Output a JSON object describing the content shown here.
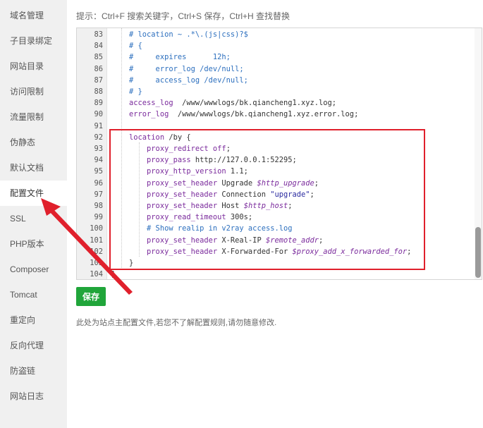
{
  "sidebar": {
    "items": [
      {
        "label": "域名管理"
      },
      {
        "label": "子目录绑定"
      },
      {
        "label": "网站目录"
      },
      {
        "label": "访问限制"
      },
      {
        "label": "流量限制"
      },
      {
        "label": "伪静态"
      },
      {
        "label": "默认文档"
      },
      {
        "label": "配置文件",
        "active": true
      },
      {
        "label": "SSL"
      },
      {
        "label": "PHP版本"
      },
      {
        "label": "Composer"
      },
      {
        "label": "Tomcat"
      },
      {
        "label": "重定向"
      },
      {
        "label": "反向代理"
      },
      {
        "label": "防盗链"
      },
      {
        "label": "网站日志"
      }
    ]
  },
  "tip": "提示：Ctrl+F 搜索关键字，Ctrl+S 保存，Ctrl+H 查找替换",
  "editor": {
    "lines": [
      {
        "n": "83",
        "segs": [
          [
            "c-cm",
            "    # location ~ .*\\.(js|css)?$"
          ]
        ]
      },
      {
        "n": "84",
        "segs": [
          [
            "c-cm",
            "    # {"
          ]
        ]
      },
      {
        "n": "85",
        "segs": [
          [
            "c-cm",
            "    #     expires      12h;"
          ]
        ]
      },
      {
        "n": "86",
        "segs": [
          [
            "c-cm",
            "    #     error_log /dev/null;"
          ]
        ]
      },
      {
        "n": "87",
        "segs": [
          [
            "c-cm",
            "    #     access_log /dev/null;"
          ]
        ]
      },
      {
        "n": "88",
        "segs": [
          [
            "c-cm",
            "    # }"
          ]
        ]
      },
      {
        "n": "89",
        "segs": [
          [
            "c-kw",
            "    access_log"
          ],
          [
            "c-plain",
            "  /www/wwwlogs/bk.qiancheng1.xyz.log;"
          ]
        ]
      },
      {
        "n": "90",
        "segs": [
          [
            "c-kw",
            "    error_log"
          ],
          [
            "c-plain",
            "  /www/wwwlogs/bk.qiancheng1.xyz.error.log;"
          ]
        ]
      },
      {
        "n": "91",
        "segs": [
          [
            "c-plain",
            ""
          ]
        ]
      },
      {
        "n": "92",
        "segs": [
          [
            "c-kw",
            "    location"
          ],
          [
            "c-plain",
            " /by {"
          ]
        ]
      },
      {
        "n": "93",
        "segs": [
          [
            "c-kw",
            "        proxy_redirect"
          ],
          [
            "c-plain",
            " "
          ],
          [
            "c-kw",
            "off"
          ],
          [
            "c-plain",
            ";"
          ]
        ]
      },
      {
        "n": "94",
        "segs": [
          [
            "c-kw",
            "        proxy_pass"
          ],
          [
            "c-plain",
            " http://127.0.0.1:52295;"
          ]
        ]
      },
      {
        "n": "95",
        "segs": [
          [
            "c-kw",
            "        proxy_http_version"
          ],
          [
            "c-plain",
            " 1.1;"
          ]
        ]
      },
      {
        "n": "96",
        "segs": [
          [
            "c-kw",
            "        proxy_set_header"
          ],
          [
            "c-plain",
            " Upgrade "
          ],
          [
            "c-var",
            "$http_upgrade"
          ],
          [
            "c-plain",
            ";"
          ]
        ]
      },
      {
        "n": "97",
        "segs": [
          [
            "c-kw",
            "        proxy_set_header"
          ],
          [
            "c-plain",
            " Connection "
          ],
          [
            "c-str",
            "\"upgrade\""
          ],
          [
            "c-plain",
            ";"
          ]
        ]
      },
      {
        "n": "98",
        "segs": [
          [
            "c-kw",
            "        proxy_set_header"
          ],
          [
            "c-plain",
            " Host "
          ],
          [
            "c-var",
            "$http_host"
          ],
          [
            "c-plain",
            ";"
          ]
        ]
      },
      {
        "n": "99",
        "segs": [
          [
            "c-kw",
            "        proxy_read_timeout"
          ],
          [
            "c-plain",
            " 300s;"
          ]
        ]
      },
      {
        "n": "100",
        "segs": [
          [
            "c-cm",
            "        # Show realip in v2ray access.log"
          ]
        ]
      },
      {
        "n": "101",
        "segs": [
          [
            "c-kw",
            "        proxy_set_header"
          ],
          [
            "c-plain",
            " X-Real-IP "
          ],
          [
            "c-var",
            "$remote_addr"
          ],
          [
            "c-plain",
            ";"
          ]
        ]
      },
      {
        "n": "102",
        "segs": [
          [
            "c-kw",
            "        proxy_set_header"
          ],
          [
            "c-plain",
            " X-Forwarded-For "
          ],
          [
            "c-var",
            "$proxy_add_x_forwarded_for"
          ],
          [
            "c-plain",
            ";"
          ]
        ]
      },
      {
        "n": "103",
        "segs": [
          [
            "c-plain",
            "    }"
          ]
        ]
      },
      {
        "n": "104",
        "segs": [
          [
            "c-plain",
            "}"
          ]
        ]
      }
    ]
  },
  "save_label": "保存",
  "note": "此处为站点主配置文件,若您不了解配置规则,请勿随意修改.",
  "colors": {
    "accent": "#20a53a",
    "annotation": "#e0202c"
  }
}
